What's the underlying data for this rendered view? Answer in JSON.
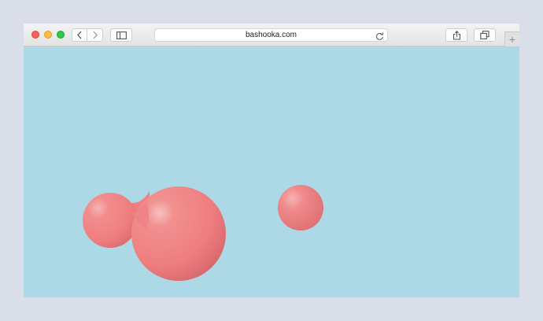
{
  "browser": {
    "url": "bashooka.com",
    "new_tab_label": "+"
  },
  "icons": {
    "close": "close-light",
    "minimize": "minimize-light",
    "zoom": "zoom-light",
    "back": "chevron-left-icon",
    "forward": "chevron-right-icon",
    "sidebar": "sidebar-icon",
    "reload": "reload-icon",
    "share": "share-icon",
    "tabs": "tabs-overview-icon"
  },
  "colors": {
    "page_background": "#add8e6",
    "blob": "#f08080"
  }
}
